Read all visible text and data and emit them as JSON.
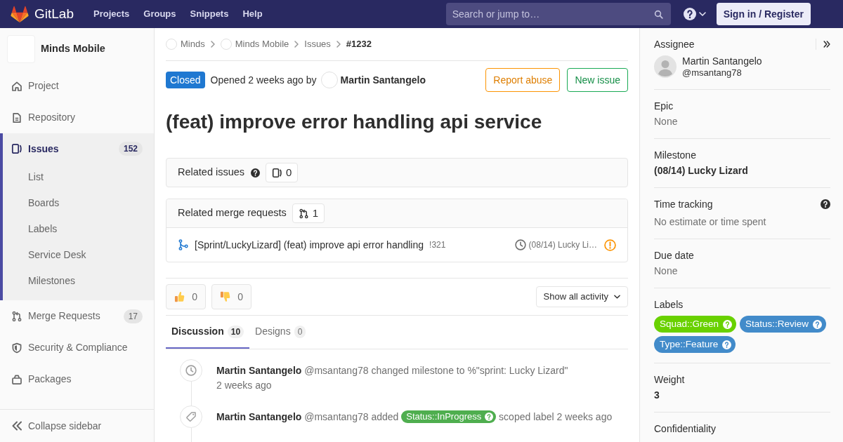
{
  "navbar": {
    "brand": "GitLab",
    "links": [
      "Projects",
      "Groups",
      "Snippets",
      "Help"
    ],
    "search": {
      "placeholder": "Search or jump to…"
    },
    "sign_in": "Sign in / Register"
  },
  "sidebar": {
    "project": "Minds Mobile",
    "items": [
      {
        "label": "Project",
        "selected": false
      },
      {
        "label": "Repository",
        "selected": false
      },
      {
        "label": "Issues",
        "count": "152",
        "selected": true,
        "children": [
          {
            "label": "List",
            "selected": false
          },
          {
            "label": "Boards",
            "selected": false
          },
          {
            "label": "Labels",
            "selected": false
          },
          {
            "label": "Service Desk",
            "selected": false
          },
          {
            "label": "Milestones",
            "selected": false
          }
        ]
      },
      {
        "label": "Merge Requests",
        "count": "17",
        "selected": false
      },
      {
        "label": "Security & Compliance",
        "selected": false
      },
      {
        "label": "Packages",
        "selected": false
      }
    ],
    "collapse": "Collapse sidebar"
  },
  "breadcrumbs": [
    {
      "label": "Minds",
      "kind": "avatar"
    },
    {
      "label": "Minds Mobile",
      "kind": "avatar"
    },
    {
      "label": "Issues",
      "kind": "link"
    },
    {
      "label": "#1232",
      "kind": "current"
    }
  ],
  "issue": {
    "status": {
      "label": "Closed",
      "kind": "closed"
    },
    "opened": "Opened 2 weeks ago by",
    "author": "Martin Santangelo",
    "actions": [
      {
        "label": "Report abuse",
        "kind": "warning"
      },
      {
        "label": "New issue",
        "kind": "success"
      }
    ],
    "title": "(feat) improve error handling api service"
  },
  "related_issues": {
    "title": "Related issues",
    "count": "0"
  },
  "related_merge_requests": {
    "title": "Related merge requests",
    "count": "1",
    "items": [
      {
        "title": "[Sprint/LuckyLizard] (feat) improve api error handling",
        "ref": "!321",
        "milestone": "(08/14) Lucky Li…",
        "pipeline_warning": true
      }
    ]
  },
  "awards": [
    {
      "kind": "thumbs_up",
      "count": "0"
    },
    {
      "kind": "thumbs_down",
      "count": "0"
    }
  ],
  "activity_filter": "Show all activity",
  "tabs": [
    {
      "label": "Discussion",
      "count": "10",
      "selected": true
    },
    {
      "label": "Designs",
      "count": "0",
      "selected": false
    }
  ],
  "notes": [
    {
      "kind": "milestone",
      "author": "Martin Santangelo",
      "handle": "@msantang78",
      "action": "changed milestone to %\"sprint: Lucky Lizard\"",
      "time": "2 weeks ago"
    },
    {
      "kind": "label",
      "author": "Martin Santangelo",
      "handle": "@msantang78",
      "action": "added",
      "label": {
        "text": "Status::InProgress",
        "color": "#4fae4f"
      },
      "action_after": "scoped label",
      "time": "2 weeks ago"
    }
  ],
  "sidebar_right": {
    "sections": [
      {
        "kind": "assignee",
        "title": "Assignee",
        "name": "Martin Santangelo",
        "username": "@msantang78"
      },
      {
        "kind": "empty",
        "title": "Epic",
        "value": "None"
      },
      {
        "kind": "value",
        "title": "Milestone",
        "value": "(08/14) Lucky Lizard"
      },
      {
        "kind": "help",
        "title": "Time tracking",
        "value": "No estimate or time spent"
      },
      {
        "kind": "empty",
        "title": "Due date",
        "value": "None"
      },
      {
        "kind": "labels",
        "title": "Labels",
        "labels": [
          {
            "text": "Squad::Green",
            "color": "#69d100"
          },
          {
            "text": "Status::Review",
            "color": "#428bca"
          },
          {
            "text": "Type::Feature",
            "color": "#428bca"
          }
        ]
      },
      {
        "kind": "value",
        "title": "Weight",
        "value": "3"
      },
      {
        "kind": "heading",
        "title": "Confidentiality"
      }
    ]
  }
}
